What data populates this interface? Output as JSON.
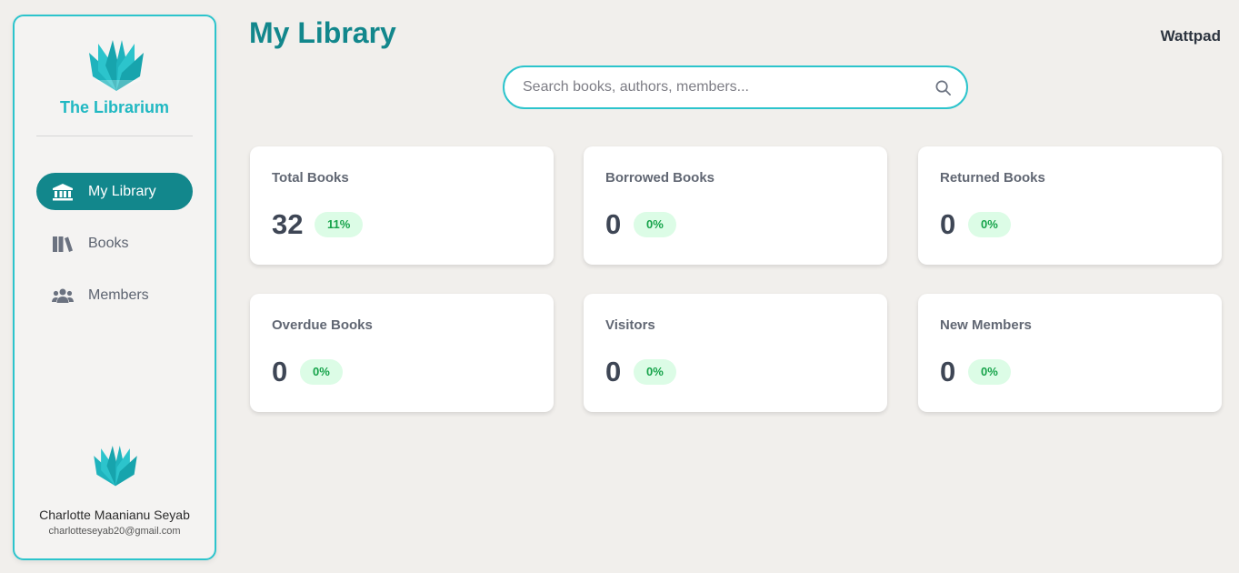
{
  "sidebar": {
    "brand": "The Librarium",
    "nav": [
      {
        "label": "My Library",
        "icon": "library-building-icon",
        "active": true
      },
      {
        "label": "Books",
        "icon": "books-icon",
        "active": false
      },
      {
        "label": "Members",
        "icon": "members-icon",
        "active": false
      }
    ],
    "user": {
      "name": "Charlotte Maanianu Seyab",
      "email": "charlotteseyab20@gmail.com"
    }
  },
  "header": {
    "title": "My Library",
    "link": "Wattpad"
  },
  "search": {
    "placeholder": "Search books, authors, members...",
    "value": ""
  },
  "stats": [
    {
      "title": "Total Books",
      "value": "32",
      "change": "11%"
    },
    {
      "title": "Borrowed Books",
      "value": "0",
      "change": "0%"
    },
    {
      "title": "Returned Books",
      "value": "0",
      "change": "0%"
    },
    {
      "title": "Overdue Books",
      "value": "0",
      "change": "0%"
    },
    {
      "title": "Visitors",
      "value": "0",
      "change": "0%"
    },
    {
      "title": "New Members",
      "value": "0",
      "change": "0%"
    }
  ],
  "colors": {
    "accent": "#12878c",
    "brand": "#20b8c2",
    "border": "#2cc4cc",
    "badge_bg": "#dcfce6",
    "badge_text": "#16a34a"
  }
}
